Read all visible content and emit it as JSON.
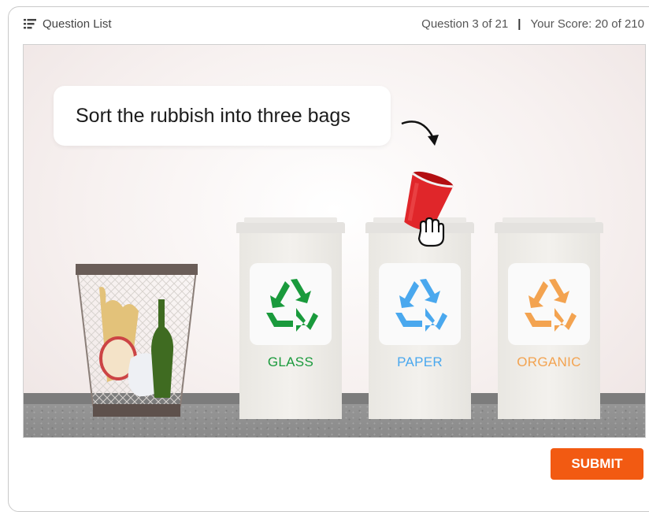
{
  "header": {
    "question_list_label": "Question List",
    "question_counter": "Question 3 of 21",
    "separator": "|",
    "score": "Your Score: 20 of 210"
  },
  "stage": {
    "instruction": "Sort the rubbish into three bags",
    "held_item": "red-paper-cup",
    "bins": [
      {
        "label": "GLASS",
        "color": "#1a9a3c"
      },
      {
        "label": "PAPER",
        "color": "#4aa8ee"
      },
      {
        "label": "ORGANIC",
        "color": "#f3a350"
      }
    ],
    "icons": {
      "list": "list-icon",
      "arrow": "curved-arrow-icon",
      "recycle": "recycle-icon",
      "hand": "grab-hand-icon",
      "basket": "wastebasket-icon",
      "cup": "paper-cup-icon"
    }
  },
  "footer": {
    "submit_label": "SUBMIT",
    "submit_color": "#f25a12"
  }
}
